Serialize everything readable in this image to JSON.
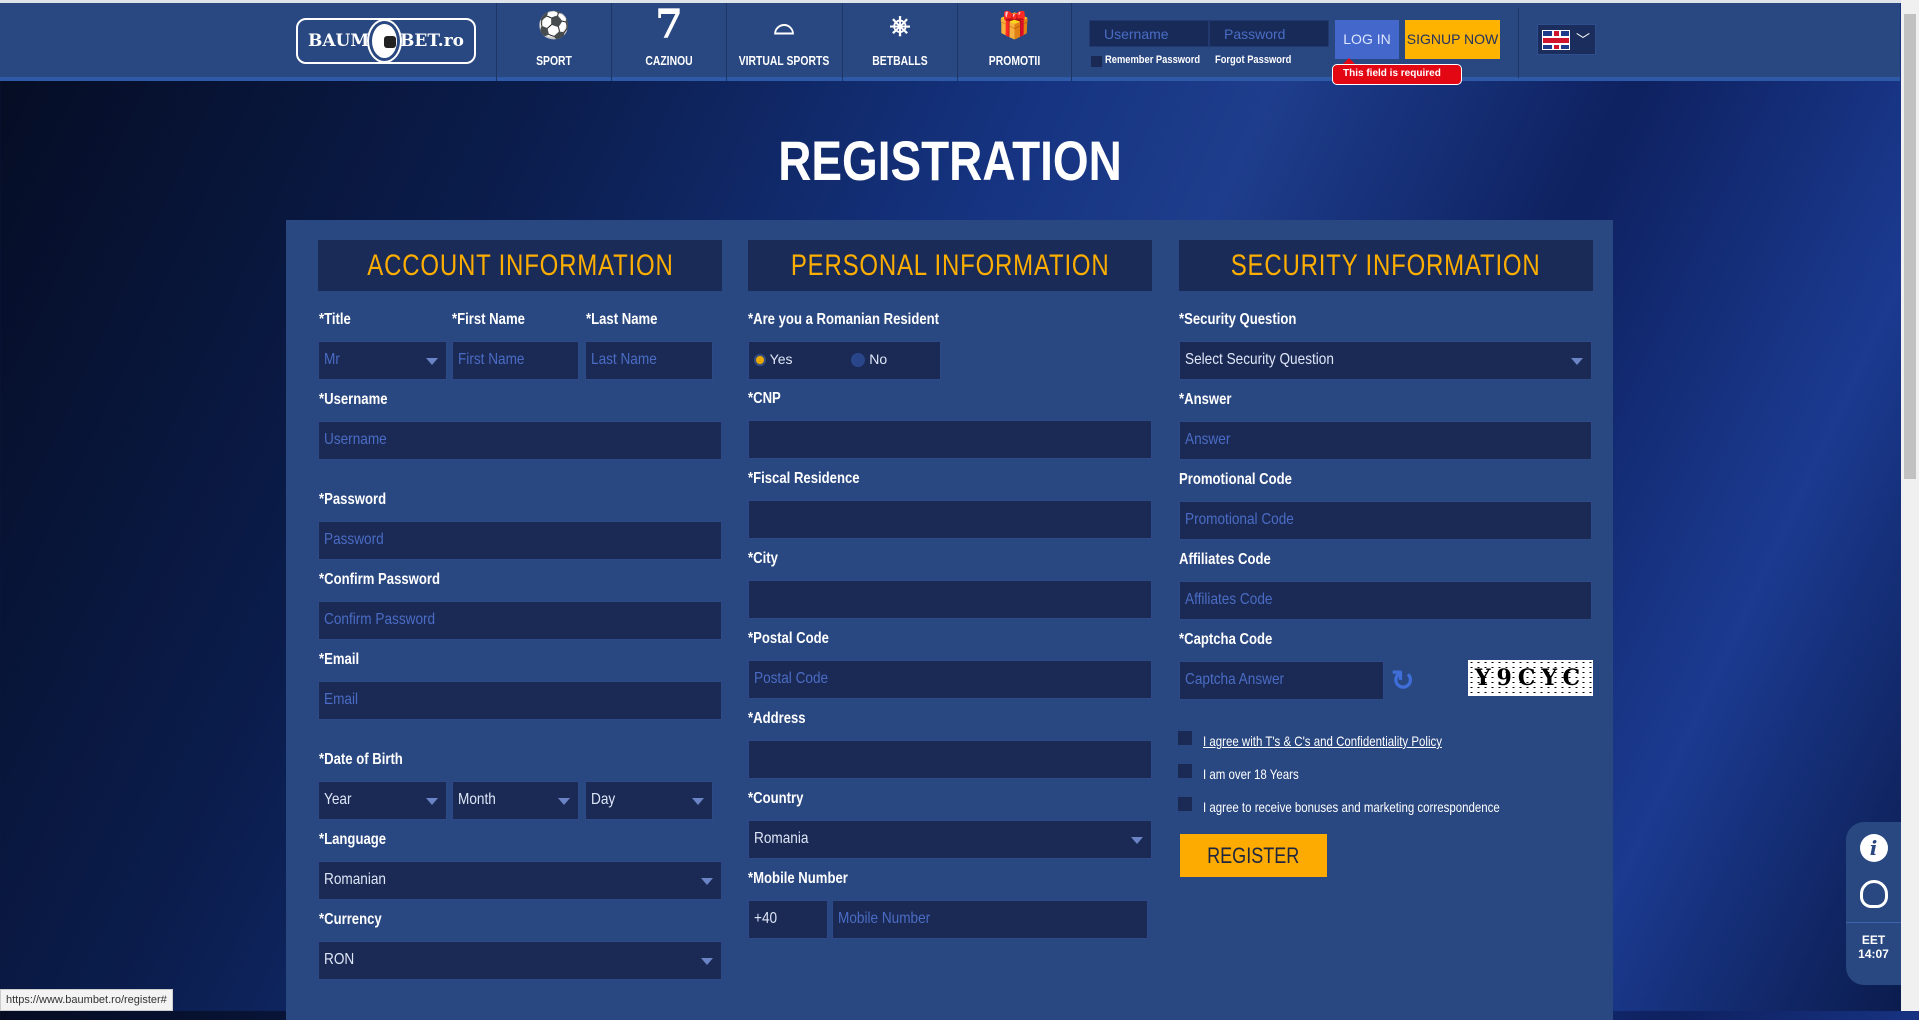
{
  "header": {
    "logo_text": "BAUM BET.ro",
    "logo_left": "BAUM",
    "logo_right": "BET.ro",
    "nav": [
      {
        "label": "SPORT",
        "icon": "soccer-ball-icon"
      },
      {
        "label": "CAZINOU",
        "icon": "seven-icon",
        "glyph": "7"
      },
      {
        "label": "VIRTUAL SPORTS",
        "icon": "vr-headset-icon"
      },
      {
        "label": "BETBALLS",
        "icon": "ferris-wheel-icon"
      },
      {
        "label": "PROMOTII",
        "icon": "gift-icon"
      }
    ],
    "username_placeholder": "Username",
    "password_placeholder": "Password",
    "remember_label": "Remember Password",
    "forgot_label": "Forgot Password",
    "login_label": "LOG IN",
    "signup_label": "SIGNUP NOW",
    "error_tooltip": "This field is required",
    "language": "en",
    "caret": "⌄"
  },
  "page_title": "REGISTRATION",
  "account": {
    "heading": "ACCOUNT INFORMATION",
    "title_label": "*Title",
    "title_value": "Mr",
    "first_name_label": "*First Name",
    "first_name_placeholder": "First Name",
    "last_name_label": "*Last Name",
    "last_name_placeholder": "Last Name",
    "username_label": "*Username",
    "username_placeholder": "Username",
    "password_label": "*Password",
    "password_placeholder": "Password",
    "confirm_label": "*Confirm Password",
    "confirm_placeholder": "Confirm Password",
    "email_label": "*Email",
    "email_placeholder": "Email",
    "dob_label": "*Date of Birth",
    "year": "Year",
    "month": "Month",
    "day": "Day",
    "language_label": "*Language",
    "language_value": "Romanian",
    "currency_label": "*Currency",
    "currency_value": "RON"
  },
  "personal": {
    "heading": "PERSONAL INFORMATION",
    "resident_label": "*Are you a Romanian Resident",
    "yes": "Yes",
    "no": "No",
    "resident_selected": "Yes",
    "cnp_label": "*CNP",
    "fiscal_label": "*Fiscal Residence",
    "city_label": "*City",
    "postal_label": "*Postal Code",
    "postal_placeholder": "Postal Code",
    "address_label": "*Address",
    "country_label": "*Country",
    "country_value": "Romania",
    "mobile_label": "*Mobile Number",
    "mobile_prefix": "+40",
    "mobile_placeholder": "Mobile Number"
  },
  "security": {
    "heading": "SECURITY INFORMATION",
    "question_label": "*Security Question",
    "question_value": "Select Security Question",
    "answer_label": "*Answer",
    "answer_placeholder": "Answer",
    "promo_label": "Promotional Code",
    "promo_placeholder": "Promotional Code",
    "affiliates_label": "Affiliates Code",
    "affiliates_placeholder": "Affiliates Code",
    "captcha_label": "*Captcha Code",
    "captcha_placeholder": "Captcha Answer",
    "captcha_image_text": "Y9CYC",
    "terms_label": "I agree with T's & C's and Confidentiality Policy",
    "age_label": "I am over 18 Years",
    "marketing_label": "I agree to receive bonuses and marketing correspondence",
    "register_label": "REGISTER"
  },
  "widget": {
    "timezone": "EET",
    "time": "14:07"
  },
  "status_url": "https://www.baumbet.ro/register#",
  "colors": {
    "header": "#294780",
    "accent": "#fdae00",
    "login": "#4467cc",
    "error": "#e30613"
  }
}
